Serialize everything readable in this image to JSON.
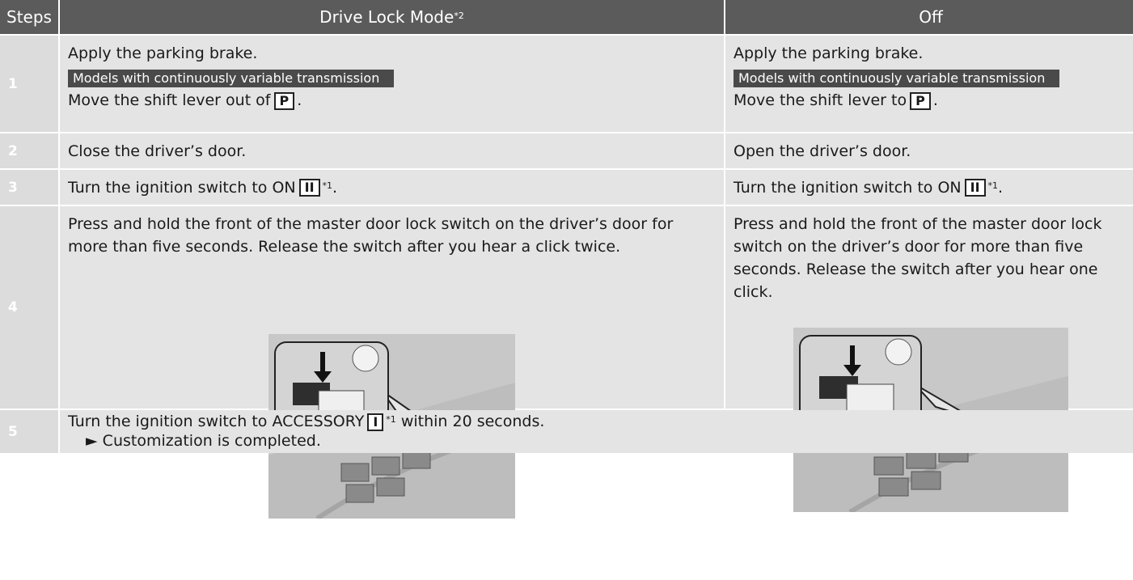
{
  "header": {
    "steps": "Steps",
    "drive_lock": "Drive Lock Mode",
    "drive_lock_note": "*2",
    "off": "Off"
  },
  "rows": {
    "r1": {
      "num": "1",
      "left_line1": "Apply the parking brake.",
      "left_tag": "Models with continuously variable transmission",
      "left_line2": "Move the shift lever out of",
      "left_key": "P",
      "left_end": ".",
      "right_line1": "Apply the parking brake.",
      "right_tag": "Models with continuously variable transmission",
      "right_line2": "Move the shift lever to",
      "right_key": "P",
      "right_end": "."
    },
    "r2": {
      "num": "2",
      "left": "Close the driver’s door.",
      "right": "Open the driver’s door."
    },
    "r3": {
      "num": "3",
      "left": "Turn the ignition switch to ON",
      "left_key": "II",
      "left_note": "*1",
      "left_end": ".",
      "right": "Turn the ignition switch to ON",
      "right_key": "II",
      "right_note": "*1",
      "right_end": "."
    },
    "r4": {
      "num": "4",
      "left": "Press and hold the front of the master door lock switch on the driver’s door for more than five seconds. Release the switch after you hear a click twice.",
      "right": "Press and hold the front of the master door lock switch on the driver’s door for more than five seconds. Release the switch after you hear one click."
    },
    "r5": {
      "num": "5",
      "line1": "Turn the ignition switch to ACCESSORY",
      "key": "I",
      "note": "*1",
      "line1_end": " within 20 seconds.",
      "arrow": "►",
      "line2": "Customization is completed."
    }
  }
}
